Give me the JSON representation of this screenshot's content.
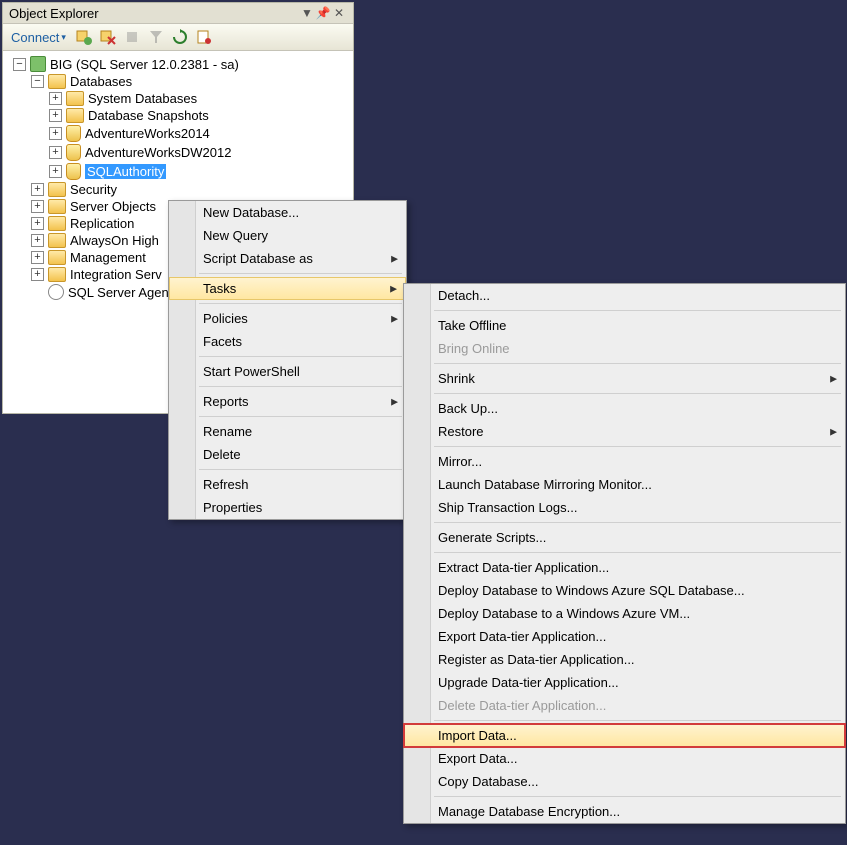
{
  "panel": {
    "title": "Object Explorer",
    "connect_label": "Connect"
  },
  "tree": {
    "server": "BIG (SQL Server 12.0.2381 - sa)",
    "databases": "Databases",
    "sysdb": "System Databases",
    "snapshots": "Database Snapshots",
    "aw2014": "AdventureWorks2014",
    "awdw2012": "AdventureWorksDW2012",
    "sqlauth": "SQLAuthority",
    "security": "Security",
    "serverobjects": "Server Objects",
    "replication": "Replication",
    "alwayson": "AlwaysOn High",
    "management": "Management",
    "integration": "Integration Serv",
    "agent": "SQL Server Agen"
  },
  "menu1": {
    "new_database": "New Database...",
    "new_query": "New Query",
    "script_db": "Script Database as",
    "tasks": "Tasks",
    "policies": "Policies",
    "facets": "Facets",
    "start_ps": "Start PowerShell",
    "reports": "Reports",
    "rename": "Rename",
    "delete": "Delete",
    "refresh": "Refresh",
    "properties": "Properties"
  },
  "menu2": {
    "detach": "Detach...",
    "take_offline": "Take Offline",
    "bring_online": "Bring Online",
    "shrink": "Shrink",
    "back_up": "Back Up...",
    "restore": "Restore",
    "mirror": "Mirror...",
    "launch_mirror": "Launch Database Mirroring Monitor...",
    "ship_logs": "Ship Transaction Logs...",
    "gen_scripts": "Generate Scripts...",
    "extract_dt": "Extract Data-tier Application...",
    "deploy_azure_db": "Deploy Database to Windows Azure SQL Database...",
    "deploy_azure_vm": "Deploy Database to a Windows Azure VM...",
    "export_dt": "Export Data-tier Application...",
    "register_dt": "Register as Data-tier Application...",
    "upgrade_dt": "Upgrade Data-tier Application...",
    "delete_dt": "Delete Data-tier Application...",
    "import_data": "Import Data...",
    "export_data": "Export Data...",
    "copy_db": "Copy Database...",
    "manage_enc": "Manage Database Encryption..."
  }
}
